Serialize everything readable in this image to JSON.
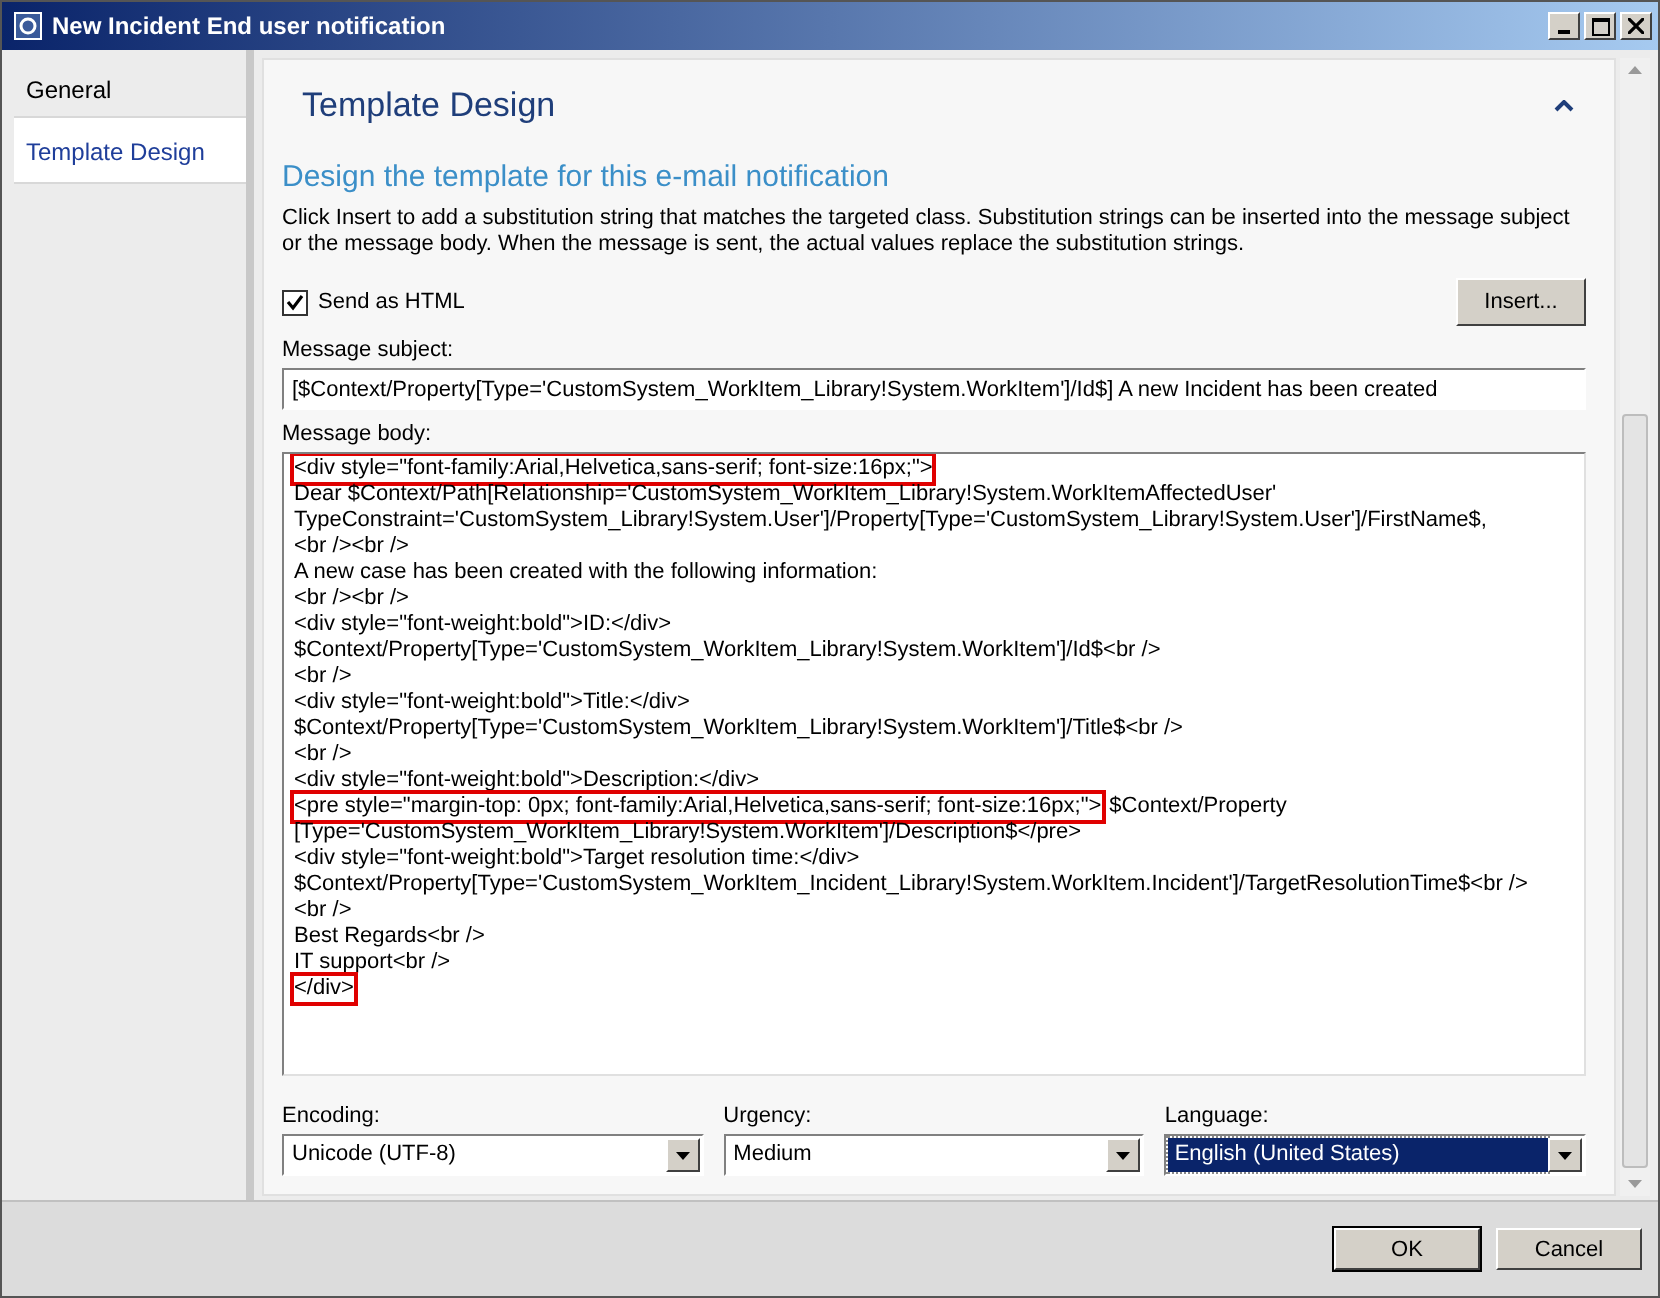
{
  "window": {
    "title": "New Incident End user notification"
  },
  "sidebar": {
    "items": [
      {
        "label": "General",
        "selected": false
      },
      {
        "label": "Template Design",
        "selected": true
      }
    ]
  },
  "section": {
    "title": "Template Design",
    "expanded": true
  },
  "heading": "Design the template for this e-mail notification",
  "description": "Click Insert to add a substitution string that matches the targeted class. Substitution strings can be inserted into the message subject or the message body. When the message is sent, the actual values replace the substitution strings.",
  "send_as_html": {
    "label": "Send as HTML",
    "checked": true
  },
  "insert_button": "Insert...",
  "subject": {
    "label": "Message subject:",
    "value": "[$Context/Property[Type='CustomSystem_WorkItem_Library!System.WorkItem']/Id$] A new Incident has been created"
  },
  "body": {
    "label": "Message body:",
    "lines": [
      [
        {
          "text": "<div style=\"font-family:Arial,Helvetica,sans-serif; font-size:16px;\">",
          "highlighted": true
        }
      ],
      [
        {
          "text": "Dear $Context/Path[Relationship='CustomSystem_WorkItem_Library!System.WorkItemAffectedUser'",
          "highlighted": false
        }
      ],
      [
        {
          "text": "TypeConstraint='CustomSystem_Library!System.User']/Property[Type='CustomSystem_Library!System.User']/FirstName$,",
          "highlighted": false
        }
      ],
      [
        {
          "text": "<br /><br />",
          "highlighted": false
        }
      ],
      [
        {
          "text": "A new case has been created with the following information:",
          "highlighted": false
        }
      ],
      [
        {
          "text": "<br /><br />",
          "highlighted": false
        }
      ],
      [
        {
          "text": "<div style=\"font-weight:bold\">ID:</div>",
          "highlighted": false
        }
      ],
      [
        {
          "text": "$Context/Property[Type='CustomSystem_WorkItem_Library!System.WorkItem']/Id$<br />",
          "highlighted": false
        }
      ],
      [
        {
          "text": "<br />",
          "highlighted": false
        }
      ],
      [
        {
          "text": "<div style=\"font-weight:bold\">Title:</div>",
          "highlighted": false
        }
      ],
      [
        {
          "text": "$Context/Property[Type='CustomSystem_WorkItem_Library!System.WorkItem']/Title$<br />",
          "highlighted": false
        }
      ],
      [
        {
          "text": "<br />",
          "highlighted": false
        }
      ],
      [
        {
          "text": "<div style=\"font-weight:bold\">Description:</div>",
          "highlighted": false
        }
      ],
      [
        {
          "text": "<pre style=\"margin-top: 0px; font-family:Arial,Helvetica,sans-serif; font-size:16px;\">",
          "highlighted": true
        },
        {
          "text": "$Context/Property",
          "highlighted": false
        }
      ],
      [
        {
          "text": "[Type='CustomSystem_WorkItem_Library!System.WorkItem']/Description$</pre>",
          "highlighted": false
        }
      ],
      [
        {
          "text": "<div style=\"font-weight:bold\">Target resolution time:</div>",
          "highlighted": false
        }
      ],
      [
        {
          "text": "$Context/Property[Type='CustomSystem_WorkItem_Incident_Library!System.WorkItem.Incident']/TargetResolutionTime$<br />",
          "highlighted": false
        }
      ],
      [
        {
          "text": "<br />",
          "highlighted": false
        }
      ],
      [
        {
          "text": "Best Regards<br />",
          "highlighted": false
        }
      ],
      [
        {
          "text": "IT support<br />",
          "highlighted": false
        }
      ],
      [
        {
          "text": "</div>",
          "highlighted": true
        }
      ]
    ]
  },
  "dropdowns": [
    {
      "label": "Encoding:",
      "value": "Unicode (UTF-8)",
      "focused": false
    },
    {
      "label": "Urgency:",
      "value": "Medium",
      "focused": false
    },
    {
      "label": "Language:",
      "value": "English (United States)",
      "focused": true
    }
  ],
  "buttons": [
    "OK",
    "Cancel"
  ]
}
